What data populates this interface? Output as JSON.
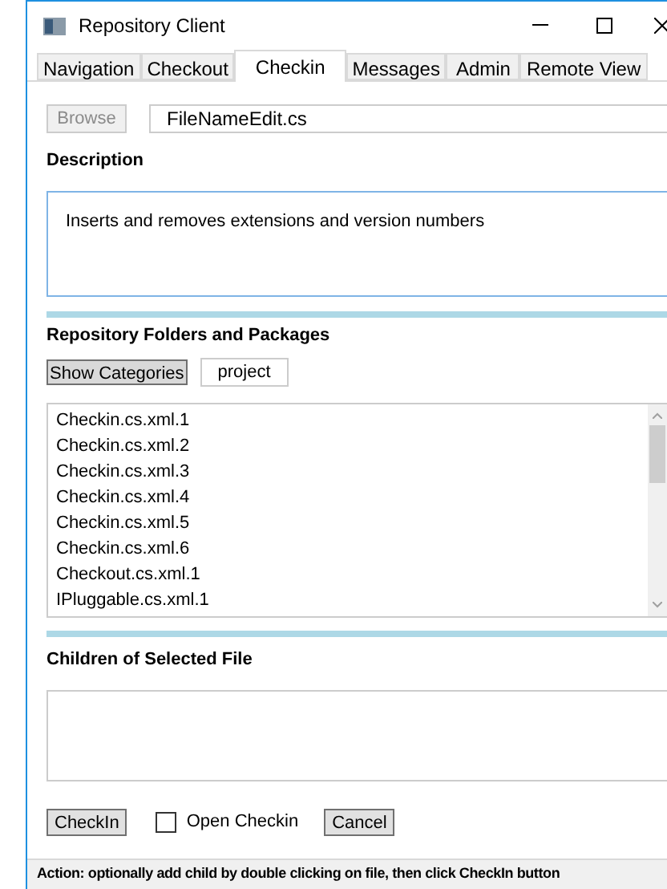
{
  "window": {
    "title": "Repository Client"
  },
  "tabs": [
    {
      "label": "Navigation",
      "selected": false
    },
    {
      "label": "Checkout",
      "selected": false
    },
    {
      "label": "Checkin",
      "selected": true
    },
    {
      "label": "Messages",
      "selected": false
    },
    {
      "label": "Admin",
      "selected": false
    },
    {
      "label": "Remote View",
      "selected": false
    }
  ],
  "file": {
    "browse_button": {
      "label": "Browse",
      "disabled": true
    },
    "value": "FileNameEdit.cs"
  },
  "description": {
    "heading": "Description",
    "value": "Inserts and removes extensions and version numbers"
  },
  "repository": {
    "heading": "Repository Folders and Packages",
    "show_categories_button": "Show Categories",
    "category_button": "project",
    "files": [
      "Checkin.cs.xml.1",
      "Checkin.cs.xml.2",
      "Checkin.cs.xml.3",
      "Checkin.cs.xml.4",
      "Checkin.cs.xml.5",
      "Checkin.cs.xml.6",
      "Checkout.cs.xml.1",
      "IPluggable.cs.xml.1"
    ]
  },
  "children": {
    "heading": "Children of Selected File"
  },
  "actions": {
    "checkin_button": "CheckIn",
    "open_checkin": {
      "label": "Open Checkin",
      "checked": false
    },
    "cancel_button": "Cancel"
  },
  "status_bar": "Action: optionally add child by double clicking on file, then click CheckIn button"
}
